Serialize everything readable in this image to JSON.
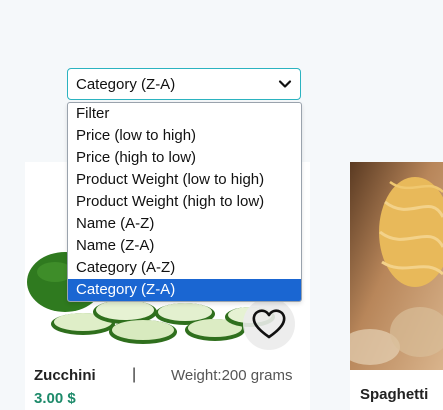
{
  "sort": {
    "selected": "Category (Z-A)",
    "options": [
      "Filter",
      "Price (low to high)",
      "Price (high to low)",
      "Product Weight (low to high)",
      "Product Weight (high to low)",
      "Name (A-Z)",
      "Name (Z-A)",
      "Category (A-Z)",
      "Category (Z-A)"
    ],
    "selected_index": 8
  },
  "products": [
    {
      "name": "Zucchini",
      "separator": "|",
      "weight": "Weight:200 grams",
      "price": "3.00 $",
      "image_icon": "zucchini-image",
      "favorite_icon": "heart-icon"
    },
    {
      "name": "Spaghetti",
      "image_icon": "spaghetti-image"
    }
  ],
  "colors": {
    "accent_border": "#2bb3c0",
    "selected_option": "#1a66d2",
    "price": "#1d8a6a"
  }
}
